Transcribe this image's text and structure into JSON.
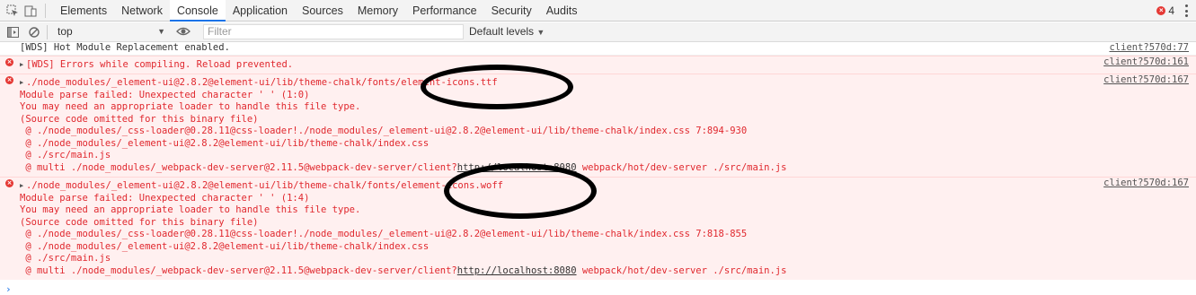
{
  "devtools": {
    "tabs": [
      "Elements",
      "Network",
      "Console",
      "Application",
      "Sources",
      "Memory",
      "Performance",
      "Security",
      "Audits"
    ],
    "active_tab": "Console",
    "error_count": "4"
  },
  "toolbar": {
    "context": "top",
    "filter_placeholder": "Filter",
    "levels": "Default levels"
  },
  "console": {
    "messages": [
      {
        "type": "info",
        "lines": [
          "[WDS] Hot Module Replacement enabled."
        ],
        "source": "client?570d:77"
      },
      {
        "type": "error",
        "lines": [
          "[WDS] Errors while compiling. Reload prevented."
        ],
        "source": "client?570d:161"
      },
      {
        "type": "error",
        "lines": [
          "./node_modules/_element-ui@2.8.2@element-ui/lib/theme-chalk/fonts/element-icons.ttf",
          "Module parse failed: Unexpected character ' ' (1:0)",
          "You may need an appropriate loader to handle this file type.",
          "(Source code omitted for this binary file)",
          " @ ./node_modules/_css-loader@0.28.11@css-loader!./node_modules/_element-ui@2.8.2@element-ui/lib/theme-chalk/index.css 7:894-930",
          " @ ./node_modules/_element-ui@2.8.2@element-ui/lib/theme-chalk/index.css",
          " @ ./src/main.js",
          " @ multi ./node_modules/_webpack-dev-server@2.11.5@webpack-dev-server/client?http://localhost:8080 webpack/hot/dev-server ./src/main.js"
        ],
        "source": "client?570d:167"
      },
      {
        "type": "error",
        "lines": [
          "./node_modules/_element-ui@2.8.2@element-ui/lib/theme-chalk/fonts/element-icons.woff",
          "Module parse failed: Unexpected character ' ' (1:4)",
          "You may need an appropriate loader to handle this file type.",
          "(Source code omitted for this binary file)",
          " @ ./node_modules/_css-loader@0.28.11@css-loader!./node_modules/_element-ui@2.8.2@element-ui/lib/theme-chalk/index.css 7:818-855",
          " @ ./node_modules/_element-ui@2.8.2@element-ui/lib/theme-chalk/index.css",
          " @ ./src/main.js",
          " @ multi ./node_modules/_webpack-dev-server@2.11.5@webpack-dev-server/client?http://localhost:8080 webpack/hot/dev-server ./src/main.js"
        ],
        "source": "client?570d:167"
      }
    ],
    "prompt": "›"
  },
  "colors": {
    "error_text": "#e0282e",
    "error_bg": "#fff0f0",
    "accent": "#1a73e8"
  }
}
